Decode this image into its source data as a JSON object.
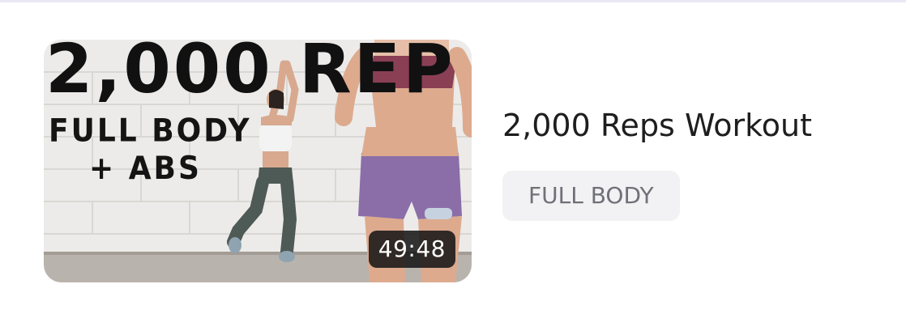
{
  "workout": {
    "thumbnail": {
      "overlay_title": "2,000 REP",
      "overlay_line1": "FULL BODY",
      "overlay_line2": "+ ABS",
      "duration": "49:48"
    },
    "title": "2,000 Reps Workout",
    "tag": "FULL BODY"
  },
  "colors": {
    "divider": "#ebe8f5",
    "tag_background": "#f2f2f4",
    "tag_text": "#707078",
    "title_text": "#1e1e1e",
    "duration_badge": "#141414"
  }
}
